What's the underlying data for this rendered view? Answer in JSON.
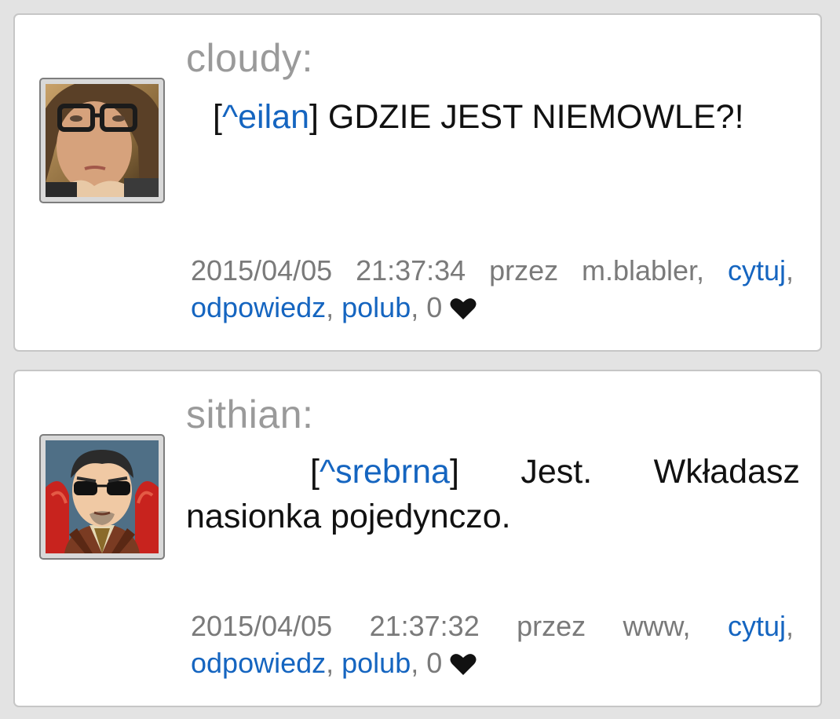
{
  "comments": [
    {
      "username": "cloudy:",
      "bracket_open": "[",
      "reference": "^eilan",
      "bracket_close": "]",
      "text": " GDZIE JEST NIEMOWLE?!",
      "meta": {
        "date": "2015/04/05",
        "time": "21:37:34",
        "by_label": "przez",
        "author": "m.blabler,",
        "quote": "cytuj",
        "reply": "odpowiedz",
        "like": "polub",
        "likes": "0"
      }
    },
    {
      "username": "sithian:",
      "bracket_open": "[",
      "reference": "^srebrna",
      "bracket_close": "]",
      "text": " Jest. Wkładasz nasionka pojedynczo.",
      "meta": {
        "date": "2015/04/05",
        "time": "21:37:32",
        "by_label": "przez",
        "author": "www,",
        "quote": "cytuj",
        "reply": "odpowiedz",
        "like": "polub",
        "likes": "0"
      }
    }
  ],
  "punct": {
    "comma": ",",
    "comma_space": ", "
  },
  "colors": {
    "link": "#1565c0",
    "username": "#9a9a9a",
    "meta": "#7a7a7a"
  },
  "icons": {
    "like": "heart-icon"
  }
}
